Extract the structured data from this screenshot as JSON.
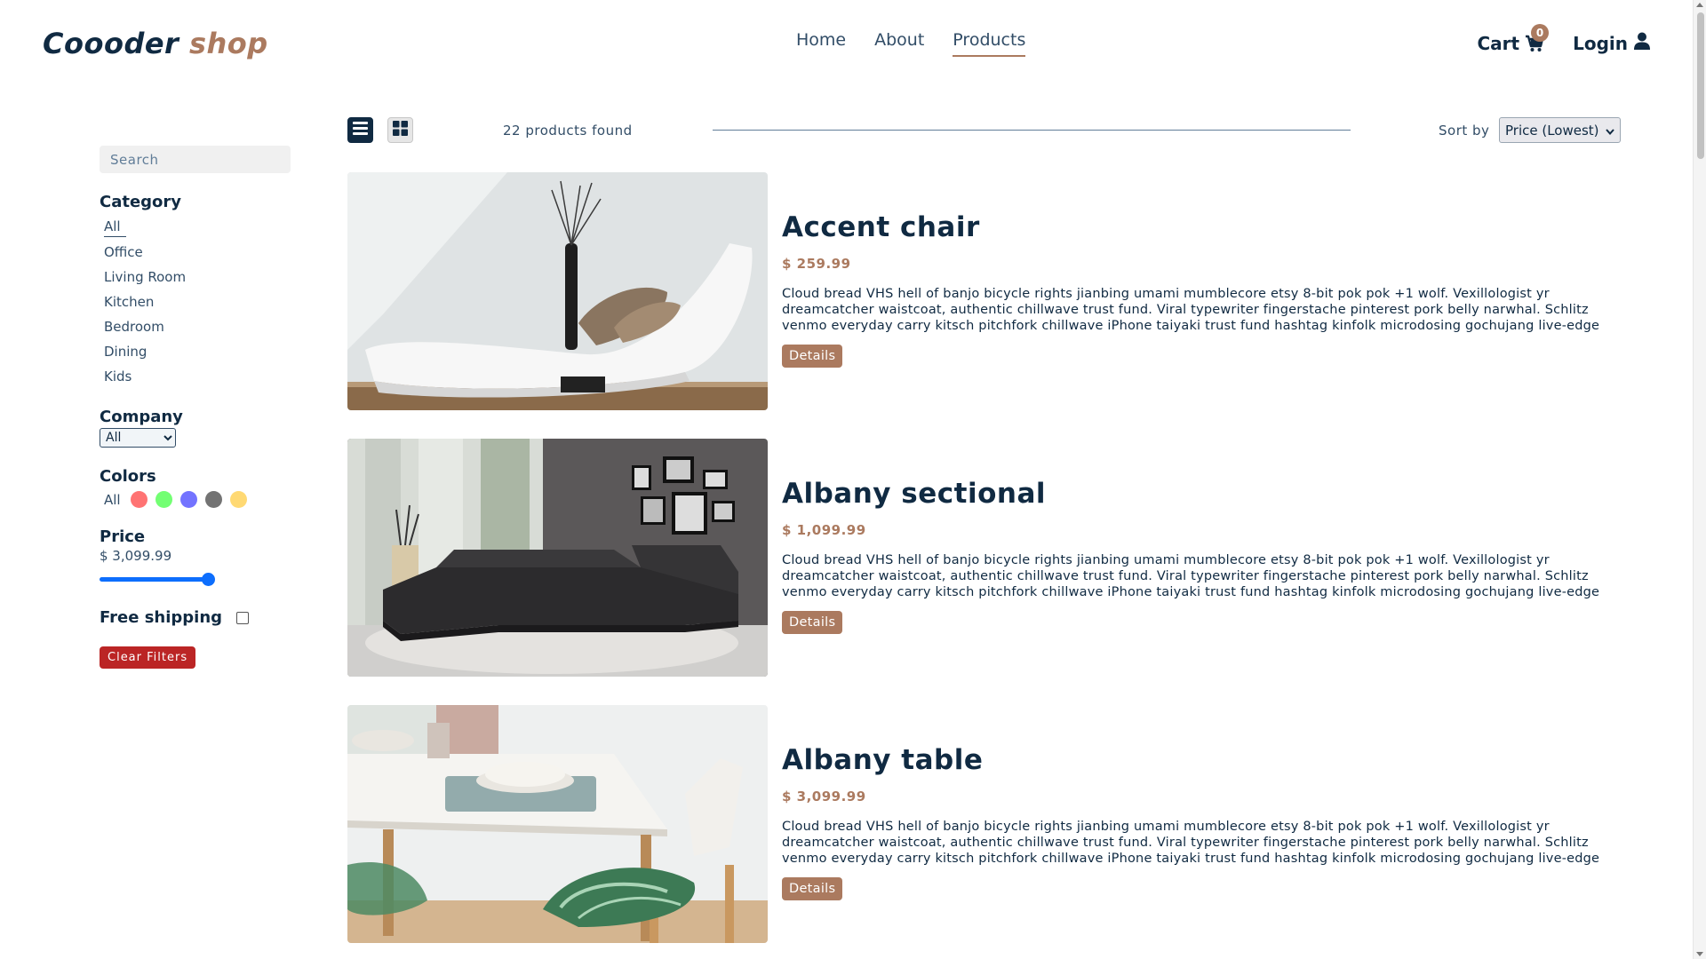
{
  "brand": {
    "name": "Coooder",
    "accent": "shop"
  },
  "nav": {
    "links": [
      {
        "label": "Home"
      },
      {
        "label": "About"
      },
      {
        "label": "Products",
        "active": true
      }
    ],
    "cart": {
      "label": "Cart",
      "count": "0"
    },
    "login": {
      "label": "Login"
    }
  },
  "filters": {
    "search_placeholder": "Search",
    "category": {
      "title": "Category",
      "items": [
        "All",
        "Office",
        "Living Room",
        "Kitchen",
        "Bedroom",
        "Dining",
        "Kids"
      ],
      "selected": "All"
    },
    "company": {
      "title": "Company",
      "selected": "All"
    },
    "colors": {
      "title": "Colors",
      "all_label": "All",
      "swatches": [
        "#ff0000",
        "#00ff00",
        "#0000ff",
        "#000000",
        "#ffb900"
      ]
    },
    "price": {
      "title": "Price",
      "value": "$ 3,099.99",
      "fraction": 1.0
    },
    "shipping": {
      "label": "Free shipping",
      "checked": false
    },
    "clear_label": "Clear Filters"
  },
  "products_header": {
    "count_text": "22 products found",
    "sort_label": "Sort by",
    "sort_selected": "Price (Lowest)",
    "view": "list"
  },
  "products": [
    {
      "name": "Accent chair",
      "price": "$ 259.99",
      "description": "Cloud bread VHS hell of banjo bicycle rights jianbing umami mumblecore etsy 8-bit pok pok +1 wolf. Vexillologist yr dreamcatcher waistcoat, authentic chillwave trust fund. Viral typewriter fingerstache pinterest pork belly narwhal. Schlitz venmo everyday carry kitsch pitchfork chillwave iPhone taiyaki trust fund hashtag kinfolk microdosing gochujang live-edge",
      "button": "Details"
    },
    {
      "name": "Albany sectional",
      "price": "$ 1,099.99",
      "description": "Cloud bread VHS hell of banjo bicycle rights jianbing umami mumblecore etsy 8-bit pok pok +1 wolf. Vexillologist yr dreamcatcher waistcoat, authentic chillwave trust fund. Viral typewriter fingerstache pinterest pork belly narwhal. Schlitz venmo everyday carry kitsch pitchfork chillwave iPhone taiyaki trust fund hashtag kinfolk microdosing gochujang live-edge",
      "button": "Details"
    },
    {
      "name": "Albany table",
      "price": "$ 3,099.99",
      "description": "Cloud bread VHS hell of banjo bicycle rights jianbing umami mumblecore etsy 8-bit pok pok +1 wolf. Vexillologist yr dreamcatcher waistcoat, authentic chillwave trust fund. Viral typewriter fingerstache pinterest pork belly narwhal. Schlitz venmo everyday carry kitsch pitchfork chillwave iPhone taiyaki trust fund hashtag kinfolk microdosing gochujang live-edge",
      "button": "Details"
    }
  ]
}
